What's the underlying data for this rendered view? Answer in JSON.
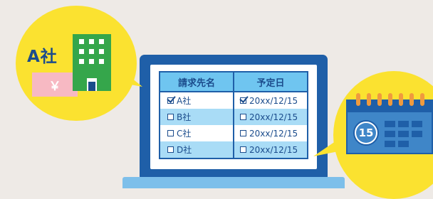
{
  "colors": {
    "background": "#eeeae6",
    "laptop": "#1f5fa8",
    "bubble": "#fbe230",
    "building": "#35a64b",
    "invoice": "#f7b9c3",
    "header": "#6fc5f0",
    "row_alt": "#a9dcf6",
    "calendar_ring": "#f09a3e"
  },
  "company_bubble": {
    "label": "A社",
    "invoice_symbol": "￥",
    "icons": [
      "building-icon",
      "yen-invoice-icon"
    ]
  },
  "table": {
    "headers": [
      "請求先名",
      "予定日"
    ],
    "rows": [
      {
        "name": "A社",
        "name_checked": true,
        "date": "20xx/12/15",
        "date_checked": true
      },
      {
        "name": "B社",
        "name_checked": false,
        "date": "20xx/12/15",
        "date_checked": false
      },
      {
        "name": "C社",
        "name_checked": false,
        "date": "20xx/12/15",
        "date_checked": false
      },
      {
        "name": "D社",
        "name_checked": false,
        "date": "20xx/12/15",
        "date_checked": false
      }
    ]
  },
  "calendar_bubble": {
    "day": "15",
    "icon": "calendar-icon"
  }
}
